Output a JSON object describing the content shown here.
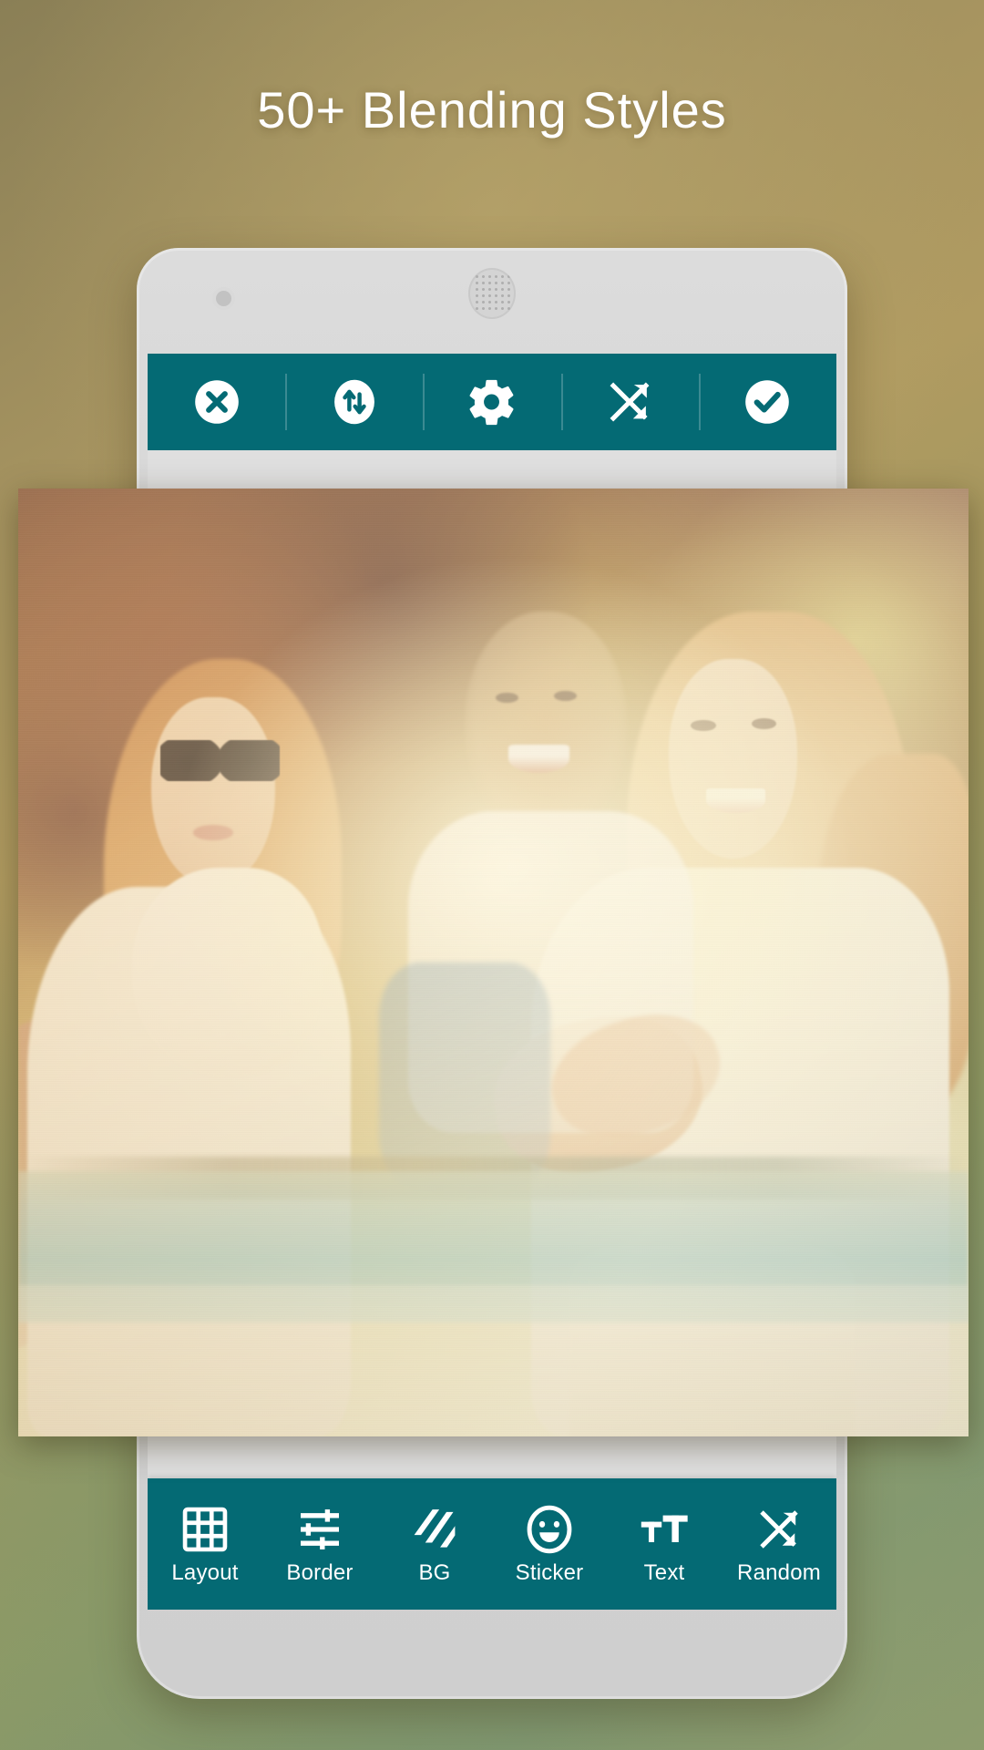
{
  "promo": {
    "headline": "50+ Blending Styles",
    "background_colors": {
      "top": "#a59360",
      "bottom": "#7d9670"
    }
  },
  "device": {
    "frame_color": "#d4d4d4",
    "camera_icon": "front-camera-icon",
    "earpiece_icon": "earpiece-speaker-icon"
  },
  "app": {
    "accent_color": "#046a74",
    "top_toolbar": {
      "items": [
        {
          "name": "close",
          "label": "Close",
          "icon": "close-circle-icon"
        },
        {
          "name": "swap",
          "label": "Swap",
          "icon": "swap-vertical-circle-icon"
        },
        {
          "name": "settings",
          "label": "Settings",
          "icon": "gear-icon"
        },
        {
          "name": "shuffle",
          "label": "Shuffle",
          "icon": "shuffle-icon"
        },
        {
          "name": "done",
          "label": "Done",
          "icon": "check-circle-icon"
        }
      ]
    },
    "bottom_toolbar": {
      "items": [
        {
          "name": "layout",
          "label": "Layout",
          "icon": "grid-icon"
        },
        {
          "name": "border",
          "label": "Border",
          "icon": "sliders-icon"
        },
        {
          "name": "bg",
          "label": "BG",
          "icon": "diagonal-stripes-icon"
        },
        {
          "name": "sticker",
          "label": "Sticker",
          "icon": "smiley-icon"
        },
        {
          "name": "text",
          "label": "Text",
          "icon": "text-size-icon"
        },
        {
          "name": "random",
          "label": "Random",
          "icon": "shuffle-icon"
        }
      ]
    },
    "canvas": {
      "description": "Blended photo collage preview",
      "blend_style": "lighten-warm"
    }
  }
}
